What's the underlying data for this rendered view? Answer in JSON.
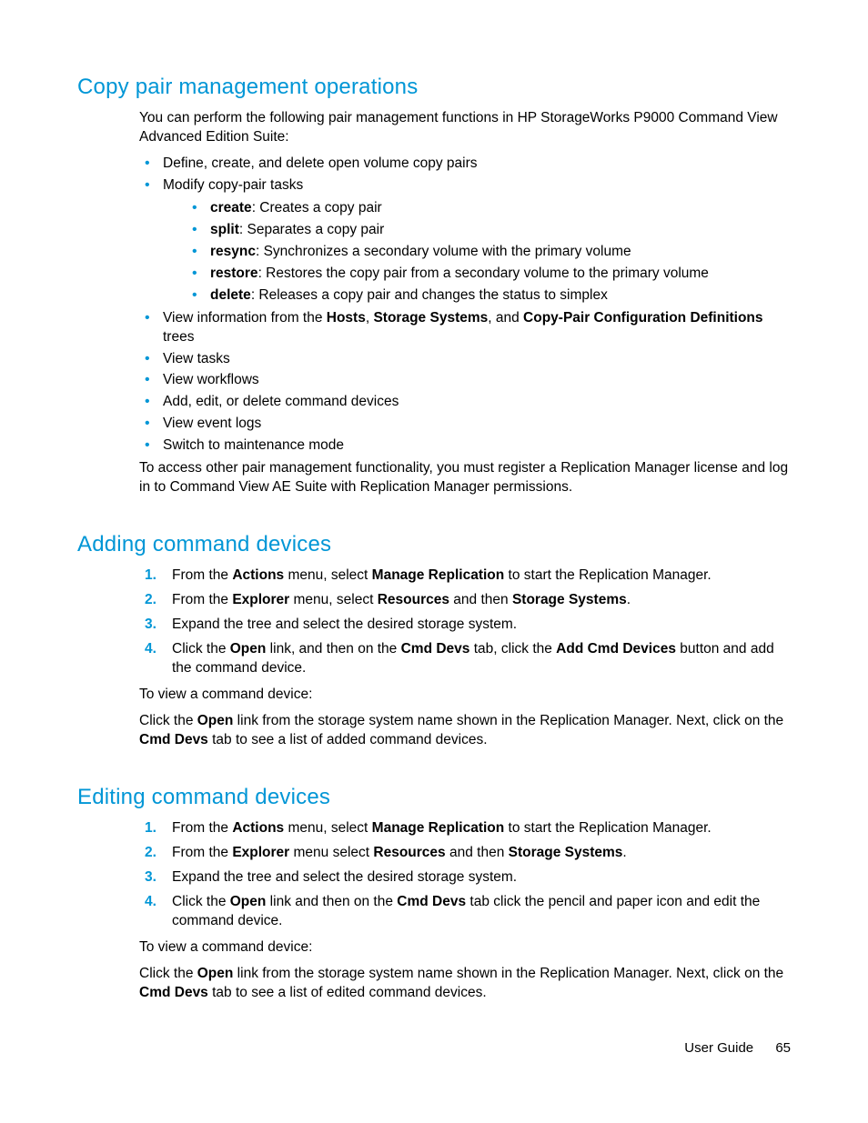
{
  "section1": {
    "title": "Copy pair management operations",
    "intro": "You can perform the following pair management functions in HP StorageWorks P9000 Command View Advanced Edition Suite:",
    "b1": "Define, create, and delete open volume copy pairs",
    "b2": "Modify copy-pair tasks",
    "sub": {
      "s1b": "create",
      "s1t": ": Creates a copy pair",
      "s2b": "split",
      "s2t": ": Separates a copy pair",
      "s3b": "resync",
      "s3t": ": Synchronizes a secondary volume with the primary volume",
      "s4b": "restore",
      "s4t": ": Restores the copy pair from a secondary volume to the primary volume",
      "s5b": "delete",
      "s5t": ": Releases a copy pair and changes the status to simplex"
    },
    "b3_pre": "View information from the ",
    "b3_h": "Hosts",
    "b3_c1": ", ",
    "b3_ss": "Storage Systems",
    "b3_c2": ", and ",
    "b3_cp": "Copy-Pair Configuration Definitions",
    "b3_post": " trees",
    "b4": "View tasks",
    "b5": "View workflows",
    "b6": "Add, edit, or delete command devices",
    "b7": "View event logs",
    "b8": "Switch to maintenance mode",
    "outro": "To access other pair management functionality, you must register a Replication Manager license and log in to Command View AE Suite with Replication Manager permissions."
  },
  "section2": {
    "title": "Adding command devices",
    "s1_a": "From the ",
    "s1_b": "Actions",
    "s1_c": " menu, select ",
    "s1_d": "Manage Replication",
    "s1_e": " to start the Replication Manager.",
    "s2_a": "From the ",
    "s2_b": "Explorer",
    "s2_c": " menu, select ",
    "s2_d": "Resources",
    "s2_e": " and then ",
    "s2_f": "Storage Systems",
    "s2_g": ".",
    "s3": "Expand the tree and select the desired storage system.",
    "s4_a": "Click the ",
    "s4_b": "Open",
    "s4_c": " link, and then on the ",
    "s4_d": "Cmd Devs",
    "s4_e": " tab, click the ",
    "s4_f": "Add Cmd Devices",
    "s4_g": " button and add the command device.",
    "note": "To view a command device:",
    "view_a": "Click the ",
    "view_b": "Open",
    "view_c": " link from the storage system name shown in the Replication Manager. Next, click on the ",
    "view_d": "Cmd Devs",
    "view_e": " tab to see a list of added command devices."
  },
  "section3": {
    "title": "Editing command devices",
    "s1_a": "From the ",
    "s1_b": "Actions",
    "s1_c": " menu, select ",
    "s1_d": "Manage Replication",
    "s1_e": " to start the Replication Manager.",
    "s2_a": "From the ",
    "s2_b": "Explorer",
    "s2_c": " menu select ",
    "s2_d": "Resources",
    "s2_e": " and then ",
    "s2_f": "Storage Systems",
    "s2_g": ".",
    "s3": "Expand the tree and select the desired storage system.",
    "s4_a": "Click the ",
    "s4_b": "Open",
    "s4_c": " link and then on the ",
    "s4_d": "Cmd Devs",
    "s4_e": " tab click the pencil and paper icon and edit the command device.",
    "note": "To view a command device:",
    "view_a": "Click the ",
    "view_b": "Open",
    "view_c": " link from the storage system name shown in the Replication Manager. Next, click on the ",
    "view_d": "Cmd Devs",
    "view_e": " tab to see a list of edited command devices."
  },
  "footer": {
    "label": "User Guide",
    "page": "65"
  }
}
